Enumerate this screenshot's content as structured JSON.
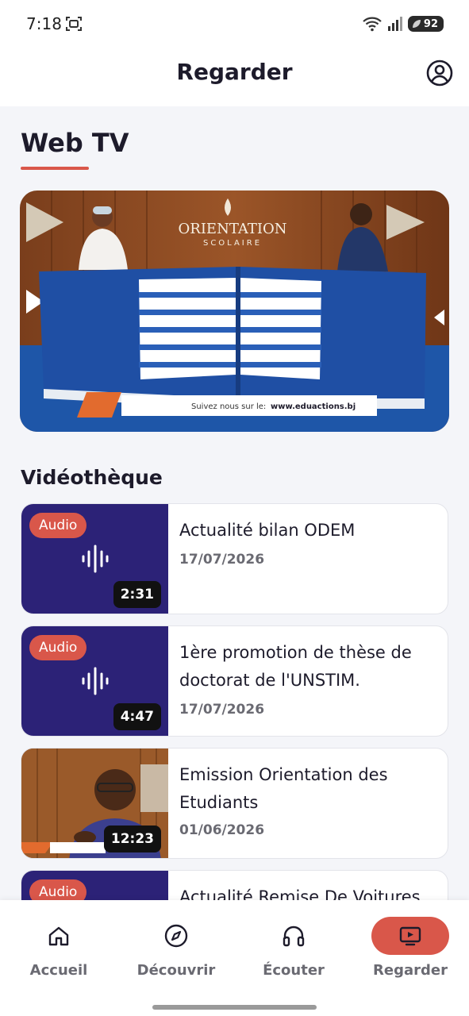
{
  "status_bar": {
    "time": "7:18",
    "battery": "92"
  },
  "app_bar": {
    "title": "Regarder",
    "account_icon": "account-circle-icon"
  },
  "web_tv": {
    "title": "Web TV",
    "banner": {
      "logo_line1": "ORIENTATION",
      "logo_line2": "SCOLAIRE",
      "ticker_prefix": "Suivez nous sur le:",
      "ticker_url": "www.eduactions.bj"
    }
  },
  "videotheque": {
    "title": "Vidéothèque",
    "items": [
      {
        "badge": "Audio",
        "duration": "2:31",
        "title": "Actualité bilan ODEM",
        "date": "17/07/2026",
        "icon": "audio-wave-icon"
      },
      {
        "badge": "Audio",
        "duration": "4:47",
        "title": "1ère promotion de thèse de doctorat de l'UNSTIM.",
        "date": "17/07/2026",
        "icon": "audio-wave-icon"
      },
      {
        "duration": "12:23",
        "title": "Emission Orientation des Etudiants",
        "date": "01/06/2026"
      },
      {
        "badge": "Audio",
        "title": "Actualité Remise De Voitures",
        "icon": "audio-wave-icon"
      }
    ]
  },
  "bottom_nav": {
    "items": [
      {
        "label": "Accueil",
        "icon": "home-icon"
      },
      {
        "label": "Découvrir",
        "icon": "compass-icon"
      },
      {
        "label": "Écouter",
        "icon": "headphones-icon"
      },
      {
        "label": "Regarder",
        "icon": "tv-play-icon",
        "active": true
      }
    ]
  },
  "colors": {
    "accent": "#d9574a",
    "audio_thumb": "#2c2277",
    "text_dark": "#1d1b2b",
    "text_muted": "#6a6a72"
  }
}
